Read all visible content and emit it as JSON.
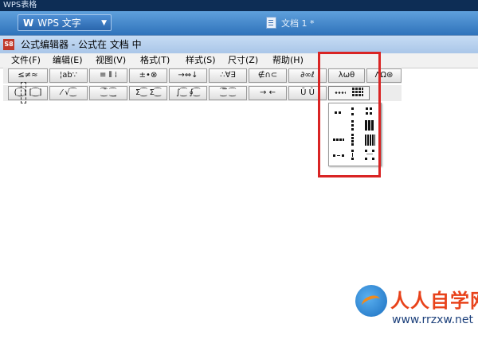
{
  "os_title": "WPS表格",
  "wps": {
    "app_button": "WPS 文字",
    "doc_tab": "文档 1 *"
  },
  "editor": {
    "icon_label": "S8",
    "title": "公式编辑器 - 公式在 文档 中"
  },
  "menu": [
    "文件(F)",
    "编辑(E)",
    "视图(V)",
    "格式(T)",
    "样式(S)",
    "尺寸(Z)",
    "帮助(H)"
  ],
  "toolbar_row1": [
    "≤≠≈",
    "¦ab∵",
    "≡ ⫴ ⁞",
    "±•⊗",
    "→⇔↓",
    "∴∀∃",
    "∉∩⊂",
    "∂∞ℓ",
    "λωθ",
    "ΛΩ⊛"
  ],
  "toolbar_row2": [
    "(⁐) [⁐]",
    "⁄ √⁐",
    "⁐̄ ⁐̲",
    "Σ⁐ Σ⁐",
    "∫⁐ ∮⁐",
    "⁐̅ ⁐",
    "→ ←",
    "Ū Û"
  ],
  "watermark": {
    "brand": "人人自学网",
    "url": "www.rrzxw.net"
  },
  "colors": {
    "highlight": "#d92424",
    "wps_blue": "#2f73bb"
  }
}
